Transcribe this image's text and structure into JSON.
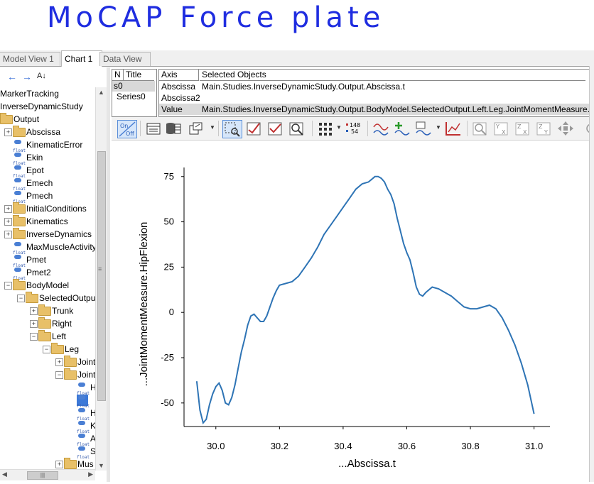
{
  "annotation": {
    "text": "MoCAP Force plate",
    "color": "#1f2de0"
  },
  "tabs": [
    {
      "label": "Model View 1",
      "active": false
    },
    {
      "label": "Chart 1",
      "active": true
    },
    {
      "label": "Data View",
      "active": false
    }
  ],
  "tree": {
    "nav": {
      "back": "back-arrow-icon",
      "forward": "forward-arrow-icon",
      "sort": "sort-az-icon"
    },
    "items": [
      {
        "label": "MarkerTracking",
        "indent": 0,
        "icon": "none",
        "expander": "none"
      },
      {
        "label": "InverseDynamicStudy",
        "indent": 0,
        "icon": "none",
        "expander": "none"
      },
      {
        "label": "Output",
        "indent": 0,
        "icon": "folder",
        "expander": "none"
      },
      {
        "label": "Abscissa",
        "indent": 1,
        "icon": "folder",
        "expander": "plus"
      },
      {
        "label": "KinematicError",
        "indent": 1,
        "icon": "float",
        "expander": "none"
      },
      {
        "label": "Ekin",
        "indent": 1,
        "icon": "float",
        "expander": "none"
      },
      {
        "label": "Epot",
        "indent": 1,
        "icon": "float",
        "expander": "none"
      },
      {
        "label": "Emech",
        "indent": 1,
        "icon": "float",
        "expander": "none"
      },
      {
        "label": "Pmech",
        "indent": 1,
        "icon": "float",
        "expander": "none"
      },
      {
        "label": "InitialConditions",
        "indent": 1,
        "icon": "folder",
        "expander": "plus"
      },
      {
        "label": "Kinematics",
        "indent": 1,
        "icon": "folder",
        "expander": "plus"
      },
      {
        "label": "InverseDynamics",
        "indent": 1,
        "icon": "folder",
        "expander": "plus"
      },
      {
        "label": "MaxMuscleActivity",
        "indent": 1,
        "icon": "float",
        "expander": "none"
      },
      {
        "label": "Pmet",
        "indent": 1,
        "icon": "float",
        "expander": "none"
      },
      {
        "label": "Pmet2",
        "indent": 1,
        "icon": "float",
        "expander": "none"
      },
      {
        "label": "BodyModel",
        "indent": 1,
        "icon": "folder",
        "expander": "minus"
      },
      {
        "label": "SelectedOutput",
        "indent": 2,
        "icon": "folder",
        "expander": "minus"
      },
      {
        "label": "Trunk",
        "indent": 3,
        "icon": "folder",
        "expander": "plus"
      },
      {
        "label": "Right",
        "indent": 3,
        "icon": "folder",
        "expander": "plus"
      },
      {
        "label": "Left",
        "indent": 3,
        "icon": "folder",
        "expander": "minus"
      },
      {
        "label": "Leg",
        "indent": 4,
        "icon": "folder",
        "expander": "minus"
      },
      {
        "label": "Joint",
        "indent": 5,
        "icon": "folder",
        "expander": "plus"
      },
      {
        "label": "Joint",
        "indent": 5,
        "icon": "folder",
        "expander": "minus"
      },
      {
        "label": "H",
        "indent": 6,
        "icon": "float",
        "expander": "none"
      },
      {
        "label": "",
        "indent": 6,
        "icon": "float",
        "expander": "none",
        "selected": true
      },
      {
        "label": "H",
        "indent": 6,
        "icon": "float",
        "expander": "none"
      },
      {
        "label": "K",
        "indent": 6,
        "icon": "float",
        "expander": "none"
      },
      {
        "label": "A",
        "indent": 6,
        "icon": "float",
        "expander": "none"
      },
      {
        "label": "S",
        "indent": 6,
        "icon": "float",
        "expander": "none"
      },
      {
        "label": "Mus",
        "indent": 5,
        "icon": "folder",
        "expander": "plus"
      }
    ],
    "float_tag": "float",
    "scroll": {
      "up": "▲",
      "down": "▼",
      "left": "◀",
      "right": "▶",
      "grip": "|||",
      "vgrip": "≡"
    }
  },
  "series_table": {
    "headers": [
      "N",
      "Title"
    ],
    "rows": [
      [
        "s0",
        "Series0"
      ]
    ]
  },
  "axis_table": {
    "headers": [
      "Axis",
      "Selected Objects"
    ],
    "rows": [
      [
        "Abscissa",
        "Main.Studies.InverseDynamicStudy.Output.Abscissa.t"
      ],
      [
        "Abscissa2",
        ""
      ],
      [
        "Value",
        "Main.Studies.InverseDynamicStudy.Output.BodyModel.SelectedOutput.Left.Leg.JointMomentMeasure."
      ]
    ]
  },
  "toolbar": {
    "onoff": {
      "on": "On",
      "off": "Off"
    },
    "counter": {
      "top": "148",
      "bottom": "54"
    },
    "icons": [
      "onoff-toggle-icon",
      "table-icon",
      "database-icon",
      "export-icon",
      "select-rect-icon",
      "check-chart-icon",
      "check-chart2-icon",
      "zoom-rect-icon",
      "grid-icon",
      "counter-icon",
      "series-icon",
      "add-series-icon",
      "series-settings-icon",
      "line-chart-icon",
      "zoom-icon",
      "zoom-yx-icon",
      "zoom-zx-icon",
      "zoom-zy-icon",
      "pan-icon",
      "more-icon"
    ],
    "zoom_labels": [
      {
        "top": "Y",
        "bottom": "X"
      },
      {
        "top": "Z",
        "bottom": "X"
      },
      {
        "top": "Z",
        "bottom": "Y"
      }
    ]
  },
  "chart_data": {
    "type": "line",
    "xlabel": "...Abscissa.t",
    "ylabel": "...JointMomentMeasure.HipFlexion",
    "xlim": [
      29.9,
      31.05
    ],
    "ylim": [
      -63,
      80
    ],
    "xticks": [
      30.0,
      30.2,
      30.4,
      30.6,
      30.8,
      31.0
    ],
    "xtick_labels": [
      "30.0",
      "30.2",
      "30.4",
      "30.6",
      "30.8",
      "31.0"
    ],
    "yticks": [
      75,
      50,
      25,
      0,
      -25,
      -50
    ],
    "ytick_labels": [
      "75",
      "50",
      "25",
      "0",
      "-25",
      "-50"
    ],
    "grid": false,
    "series": [
      {
        "color": "#2e74b5",
        "x": [
          29.94,
          29.95,
          29.96,
          29.97,
          29.98,
          29.99,
          30.0,
          30.01,
          30.02,
          30.03,
          30.04,
          30.05,
          30.06,
          30.07,
          30.08,
          30.09,
          30.1,
          30.11,
          30.12,
          30.13,
          30.14,
          30.15,
          30.16,
          30.17,
          30.18,
          30.19,
          30.2,
          30.22,
          30.24,
          30.26,
          30.28,
          30.3,
          30.32,
          30.34,
          30.36,
          30.38,
          30.4,
          30.42,
          30.44,
          30.46,
          30.48,
          30.5,
          30.51,
          30.52,
          30.53,
          30.54,
          30.55,
          30.56,
          30.57,
          30.58,
          30.59,
          30.6,
          30.61,
          30.62,
          30.63,
          30.64,
          30.65,
          30.66,
          30.68,
          30.7,
          30.72,
          30.74,
          30.76,
          30.78,
          30.8,
          30.82,
          30.84,
          30.86,
          30.88,
          30.9,
          30.92,
          30.94,
          30.96,
          30.98,
          31.0
        ],
        "values": [
          -38,
          -54,
          -61,
          -59,
          -51,
          -45,
          -41,
          -39,
          -43,
          -50,
          -51,
          -47,
          -40,
          -31,
          -22,
          -15,
          -7,
          -2,
          -1,
          -3,
          -5,
          -5,
          -2,
          3,
          8,
          12,
          15,
          16,
          17,
          20,
          25,
          30,
          36,
          43,
          48,
          53,
          58,
          63,
          68,
          71,
          72,
          75,
          75,
          74,
          72,
          68,
          65,
          60,
          52,
          45,
          38,
          33,
          29,
          22,
          14,
          10,
          9,
          11,
          14,
          13,
          11,
          9,
          6,
          3,
          2,
          2,
          3,
          4,
          2,
          -3,
          -10,
          -18,
          -28,
          -40,
          -56
        ]
      }
    ]
  }
}
